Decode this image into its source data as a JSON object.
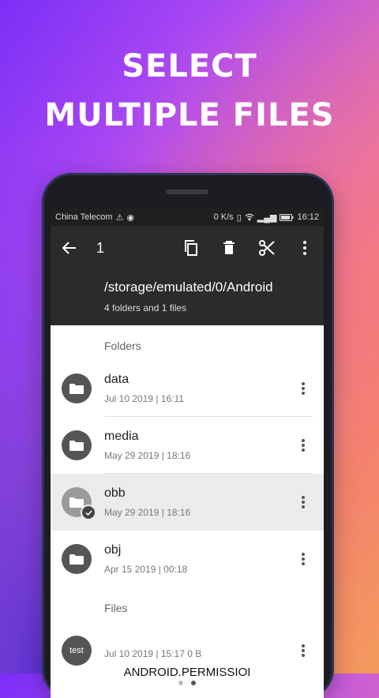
{
  "headline": {
    "line1": "SELECT",
    "line2": "MULTIPLE FILES"
  },
  "status": {
    "carrier": "China Telecom",
    "speed": "0 K/s",
    "time": "16:12"
  },
  "appbar": {
    "selected_count": "1"
  },
  "path": {
    "current": "/storage/emulated/0/Android",
    "summary": "4 folders and 1 files"
  },
  "sections": {
    "folders": "Folders",
    "files": "Files"
  },
  "folders": [
    {
      "name": "data",
      "meta": "Jul 10 2019 | 16:11",
      "selected": false
    },
    {
      "name": "media",
      "meta": "May 29 2019 | 18:16",
      "selected": false
    },
    {
      "name": "obb",
      "meta": "May 29 2019 | 18:16",
      "selected": true
    },
    {
      "name": "obj",
      "meta": "Apr 15 2019 | 00:18",
      "selected": false
    }
  ],
  "files": [
    {
      "name": "",
      "meta": "Jul 10 2019 | 15:17   0 B",
      "badge": "test"
    }
  ],
  "toast": "ANDROID.PERMISSIOI",
  "colors": {
    "appbar": "#2b2b2b",
    "selected_row": "#ececec"
  }
}
